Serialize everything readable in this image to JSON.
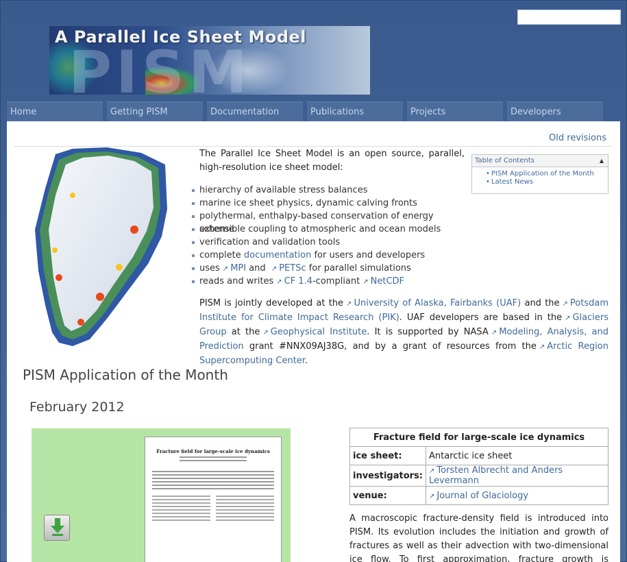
{
  "banner": {
    "title": "A Parallel Ice Sheet Model",
    "logo": "PISM"
  },
  "nav": [
    {
      "label": "Home"
    },
    {
      "label": "Getting PISM"
    },
    {
      "label": "Documentation"
    },
    {
      "label": "Publications"
    },
    {
      "label": "Projects"
    },
    {
      "label": "Developers"
    }
  ],
  "old_revisions": "Old revisions",
  "intro": "The Parallel Ice Sheet Model is an open source, parallel, high-resolution ice sheet model:",
  "features": {
    "f1": "hierarchy of available stress balances",
    "f2": "marine ice sheet physics, dynamic calving fronts",
    "f3": "polythermal, enthalpy-based conservation of energy scheme",
    "f4": "extensible coupling to atmospheric and ocean models",
    "f5": "verification and validation tools",
    "f6_pre": "complete ",
    "f6_link": "documentation",
    "f6_post": " for users and developers",
    "f7_pre": "uses",
    "f7_l1": "MPI",
    "f7_mid": " and ",
    "f7_l2": "PETSc",
    "f7_post": " for parallel simulations",
    "f8_pre": "reads and writes",
    "f8_l1": "CF 1.4",
    "f8_mid": "-compliant",
    "f8_l2": "NetCDF"
  },
  "toc": {
    "header": "Table of Contents",
    "items": [
      "PISM Application of the Month",
      "Latest News"
    ]
  },
  "para2": {
    "t1": "PISM is jointly developed at the",
    "l1": "University of Alaska, Fairbanks (UAF)",
    "t2": " and the",
    "l2": "Potsdam Institute for Climate Impact Research (PIK)",
    "t3": ". UAF developers are based in the",
    "l3": "Glaciers Group",
    "t4": " at the",
    "l4": "Geophysical Institute",
    "t5": ". It is supported by NASA",
    "l5": "Modeling, Analysis, and Prediction",
    "t6": " grant #NNX09AJ38G, and by a grant of resources from the",
    "l6": "Arctic Region Supercomputing Center",
    "t7": "."
  },
  "section_title": "PISM Application of the Month",
  "month": "February 2012",
  "paper": {
    "title": "Fracture field for large-scale ice dynamics"
  },
  "table": {
    "caption": "Fracture field for large-scale ice dynamics",
    "k1": "ice sheet",
    "v1": "Antarctic ice sheet",
    "k2": "investigators",
    "v2": "Torsten Albrecht and Anders Levermann",
    "k3": "venue",
    "v3": "Journal of Glaciology",
    "colon": ":"
  },
  "description": "A macroscopic fracture-density field is introduced into PISM. Its evolution includes the initiation and growth of fractures as well as their advection with two-dimensional ice flow. To first approximation, fracture growth is assumed to depend on the",
  "icons": {
    "external": "external-link-icon",
    "download": "download-icon",
    "toggle": "collapse-icon"
  }
}
